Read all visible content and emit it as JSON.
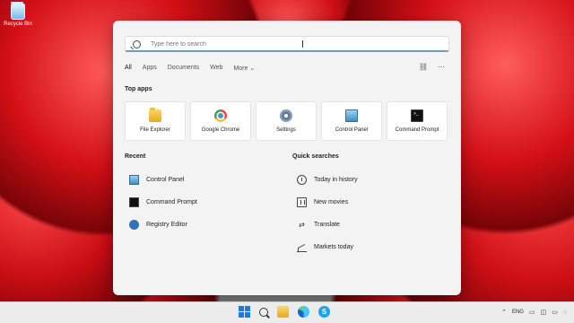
{
  "desktop": {
    "icons": [
      {
        "label": "Recycle Bin"
      }
    ]
  },
  "search": {
    "placeholder": "Type here to search",
    "value": ""
  },
  "tabs": [
    {
      "label": "All"
    },
    {
      "label": "Apps"
    },
    {
      "label": "Documents"
    },
    {
      "label": "Web"
    },
    {
      "label": "More"
    }
  ],
  "sections": {
    "top_apps": "Top apps",
    "recent": "Recent",
    "quick_searches": "Quick searches"
  },
  "top_apps": [
    {
      "label": "File Explorer",
      "icon": "folder-icon"
    },
    {
      "label": "Google Chrome",
      "icon": "chrome-icon"
    },
    {
      "label": "Settings",
      "icon": "gear-icon"
    },
    {
      "label": "Control Panel",
      "icon": "control-panel-icon"
    },
    {
      "label": "Command Prompt",
      "icon": "terminal-icon"
    }
  ],
  "recent": [
    {
      "label": "Control Panel",
      "icon": "control-panel-icon"
    },
    {
      "label": "Command Prompt",
      "icon": "terminal-icon"
    },
    {
      "label": "Registry Editor",
      "icon": "registry-icon"
    }
  ],
  "quick_searches": [
    {
      "label": "Today in history",
      "icon": "clock-icon"
    },
    {
      "label": "New movies",
      "icon": "film-icon"
    },
    {
      "label": "Translate",
      "icon": "translate-icon"
    },
    {
      "label": "Markets today",
      "icon": "chart-icon"
    }
  ],
  "taskbar": {
    "language": "ENG"
  },
  "colors": {
    "accent": "#1f7ae0",
    "panel": "#f3f3f3",
    "taskbar": "#ececec",
    "wallpaper_red": "#d30f16"
  }
}
